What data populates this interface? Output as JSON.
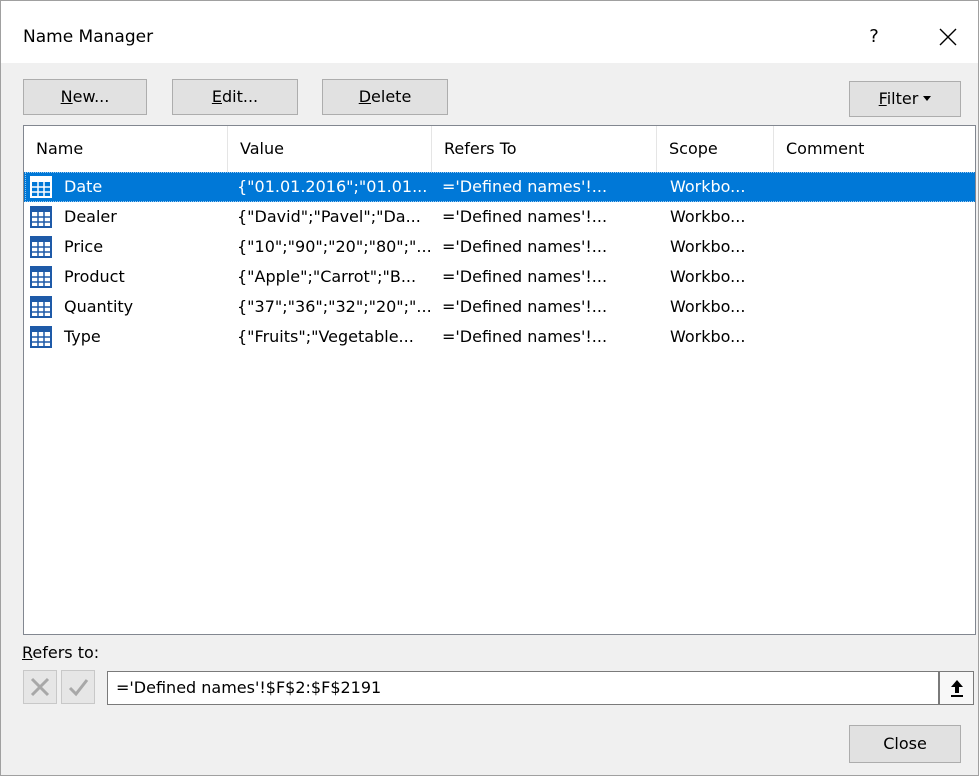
{
  "window": {
    "title": "Name Manager",
    "help": "?"
  },
  "toolbar": {
    "new_mnemonic": "N",
    "new_rest": "ew...",
    "edit_mnemonic": "E",
    "edit_rest": "dit...",
    "delete_mnemonic": "D",
    "delete_rest": "elete",
    "filter_mnemonic": "F",
    "filter_rest": "ilter"
  },
  "table": {
    "columns": [
      "Name",
      "Value",
      "Refers To",
      "Scope",
      "Comment"
    ],
    "rows": [
      {
        "name": "Date",
        "value": "{\"01.01.2016\";\"01.01...",
        "refers": "='Defined names'!...",
        "scope": "Workbo...",
        "comment": "",
        "selected": true
      },
      {
        "name": "Dealer",
        "value": "{\"David\";\"Pavel\";\"Da...",
        "refers": "='Defined names'!...",
        "scope": "Workbo...",
        "comment": ""
      },
      {
        "name": "Price",
        "value": "{\"10\";\"90\";\"20\";\"80\";\"...",
        "refers": "='Defined names'!...",
        "scope": "Workbo...",
        "comment": ""
      },
      {
        "name": "Product",
        "value": "{\"Apple\";\"Carrot\";\"B...",
        "refers": "='Defined names'!...",
        "scope": "Workbo...",
        "comment": ""
      },
      {
        "name": "Quantity",
        "value": "{\"37\";\"36\";\"32\";\"20\";\"...",
        "refers": "='Defined names'!...",
        "scope": "Workbo...",
        "comment": ""
      },
      {
        "name": "Type",
        "value": "{\"Fruits\";\"Vegetable...",
        "refers": "='Defined names'!...",
        "scope": "Workbo...",
        "comment": ""
      }
    ]
  },
  "refers_to": {
    "label_mnemonic": "R",
    "label_rest": "efers to:",
    "value": "='Defined names'!$F$2:$F$2191"
  },
  "footer": {
    "close_label": "Close"
  },
  "colors": {
    "selection": "#0078d7",
    "table_icon": "#1e5aa8"
  }
}
